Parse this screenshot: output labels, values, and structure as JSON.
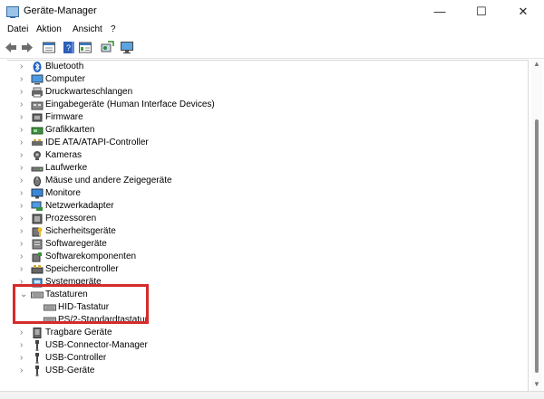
{
  "window": {
    "title": "Geräte-Manager",
    "minimize": "—",
    "maximize": "☐",
    "close": "✕"
  },
  "menu": [
    {
      "label": "Datei"
    },
    {
      "label": "Aktion"
    },
    {
      "label": "Ansicht"
    },
    {
      "label": "?"
    }
  ],
  "toolbar": [
    "back-arrow-icon",
    "forward-arrow-icon",
    "properties-icon",
    "help-icon",
    "details-icon",
    "scan-hardware-icon",
    "monitor-icon"
  ],
  "tree": {
    "items": [
      {
        "label": "Bluetooth",
        "icon": "bluetooth-icon",
        "expanded": false
      },
      {
        "label": "Computer",
        "icon": "computer-icon",
        "expanded": false
      },
      {
        "label": "Druckwarteschlangen",
        "icon": "printer-icon",
        "expanded": false
      },
      {
        "label": "Eingabegeräte (Human Interface Devices)",
        "icon": "hid-icon",
        "expanded": false
      },
      {
        "label": "Firmware",
        "icon": "firmware-icon",
        "expanded": false
      },
      {
        "label": "Grafikkarten",
        "icon": "display-adapter-icon",
        "expanded": false
      },
      {
        "label": "IDE ATA/ATAPI-Controller",
        "icon": "ide-controller-icon",
        "expanded": false
      },
      {
        "label": "Kameras",
        "icon": "camera-icon",
        "expanded": false
      },
      {
        "label": "Laufwerke",
        "icon": "disk-drive-icon",
        "expanded": false
      },
      {
        "label": "Mäuse und andere Zeigegeräte",
        "icon": "mouse-icon",
        "expanded": false
      },
      {
        "label": "Monitore",
        "icon": "monitor-icon",
        "expanded": false
      },
      {
        "label": "Netzwerkadapter",
        "icon": "network-adapter-icon",
        "expanded": false
      },
      {
        "label": "Prozessoren",
        "icon": "processor-icon",
        "expanded": false
      },
      {
        "label": "Sicherheitsgeräte",
        "icon": "security-device-icon",
        "expanded": false
      },
      {
        "label": "Softwaregeräte",
        "icon": "software-device-icon",
        "expanded": false
      },
      {
        "label": "Softwarekomponenten",
        "icon": "software-component-icon",
        "expanded": false
      },
      {
        "label": "Speichercontroller",
        "icon": "storage-controller-icon",
        "expanded": false
      },
      {
        "label": "Systemgeräte",
        "icon": "system-device-icon",
        "expanded": false
      },
      {
        "label": "Tastaturen",
        "icon": "keyboard-icon",
        "expanded": true,
        "children": [
          {
            "label": "HID-Tastatur",
            "icon": "keyboard-icon"
          },
          {
            "label": "PS/2-Standardtastatur",
            "icon": "keyboard-icon"
          }
        ]
      },
      {
        "label": "Tragbare Geräte",
        "icon": "portable-device-icon",
        "expanded": false
      },
      {
        "label": "USB-Connector-Manager",
        "icon": "usb-icon",
        "expanded": false
      },
      {
        "label": "USB-Controller",
        "icon": "usb-icon",
        "expanded": false
      },
      {
        "label": "USB-Geräte",
        "icon": "usb-icon",
        "expanded": false
      }
    ]
  },
  "colors": {
    "highlight": "#d52b2b",
    "accent": "#0a74da"
  }
}
